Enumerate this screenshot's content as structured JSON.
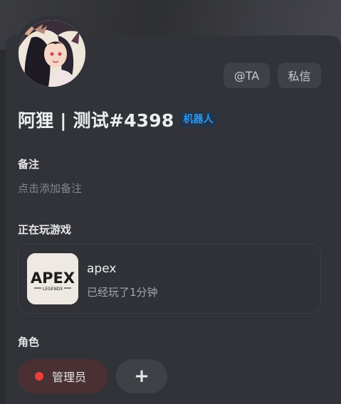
{
  "header": {
    "at_button": "@TA",
    "dm_button": "私信"
  },
  "user": {
    "display_name": "阿狸 | 测试#4398",
    "bot_tag": "机器人"
  },
  "note": {
    "title": "备注",
    "placeholder": "点击添加备注"
  },
  "activity": {
    "title": "正在玩游戏",
    "game_name": "apex",
    "elapsed": "已经玩了1分钟",
    "logo_text": "APEX",
    "logo_subtext": "LEGENDS"
  },
  "roles": {
    "title": "角色",
    "items": [
      {
        "label": "管理员",
        "color": "#ee3e3a"
      }
    ],
    "add_icon": "plus-icon",
    "add_symbol": "+"
  },
  "colors": {
    "background": "#2b2c30",
    "card": "#323338",
    "bot_tag_text": "#2a97f0",
    "role_chip_bg": "#4a3033"
  }
}
